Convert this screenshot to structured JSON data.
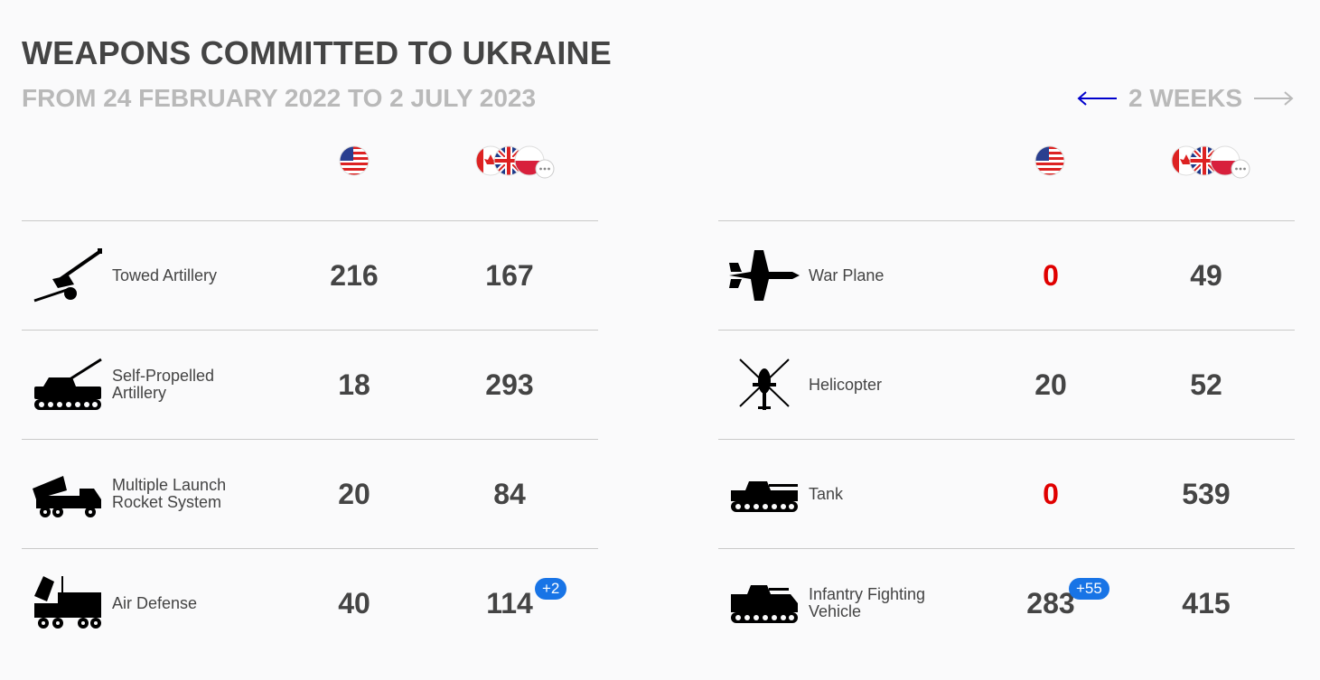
{
  "header": {
    "title": "WEAPONS COMMITTED TO UKRAINE",
    "subtitle": "FROM 24 FEBRUARY 2022 TO 2 JULY 2023",
    "period_label": "2 WEEKS"
  },
  "colors": {
    "text": "#444444",
    "muted": "#b9b9b9",
    "zero": "#e00000",
    "badge": "#1874e6",
    "arrow_active": "#0000cc"
  },
  "columns": {
    "us_flag": "us-flag-icon",
    "others_flags": [
      "canada-flag-icon",
      "uk-flag-icon",
      "poland-flag-icon",
      "more-icon"
    ]
  },
  "left_rows": [
    {
      "label": "Towed Artillery",
      "icon": "towed-artillery-icon",
      "us": "216",
      "others": "167",
      "us_badge": "",
      "others_badge": ""
    },
    {
      "label": "Self-Propelled Artillery",
      "icon": "self-propelled-artillery-icon",
      "us": "18",
      "others": "293",
      "us_badge": "",
      "others_badge": ""
    },
    {
      "label": "Multiple Launch Rocket System",
      "icon": "rocket-launcher-icon",
      "us": "20",
      "others": "84",
      "us_badge": "",
      "others_badge": ""
    },
    {
      "label": "Air Defense",
      "icon": "air-defense-icon",
      "us": "40",
      "others": "114",
      "us_badge": "",
      "others_badge": "+2"
    }
  ],
  "right_rows": [
    {
      "label": "War Plane",
      "icon": "war-plane-icon",
      "us": "0",
      "others": "49",
      "us_badge": "",
      "others_badge": ""
    },
    {
      "label": "Helicopter",
      "icon": "helicopter-icon",
      "us": "20",
      "others": "52",
      "us_badge": "",
      "others_badge": ""
    },
    {
      "label": "Tank",
      "icon": "tank-icon",
      "us": "0",
      "others": "539",
      "us_badge": "",
      "others_badge": ""
    },
    {
      "label": "Infantry Fighting Vehicle",
      "icon": "ifv-icon",
      "us": "283",
      "others": "415",
      "us_badge": "+55",
      "others_badge": ""
    }
  ]
}
